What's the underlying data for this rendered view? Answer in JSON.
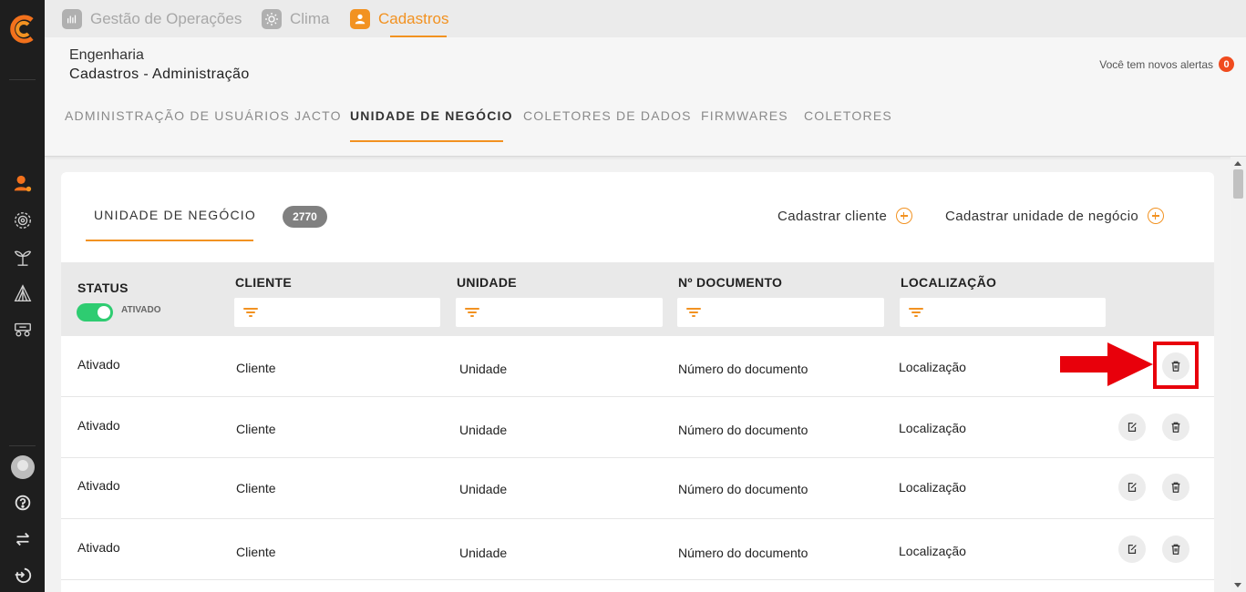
{
  "colors": {
    "accent": "#f29221",
    "sidebar": "#1e1e1e",
    "toggle_on": "#2ecc71",
    "alert": "#f04b1e",
    "highlight": "#e8000b"
  },
  "app_tabs": [
    {
      "label": "Gestão de Operações",
      "icon": "chart-hand-icon"
    },
    {
      "label": "Clima",
      "icon": "sun-icon"
    },
    {
      "label": "Cadastros",
      "icon": "user-icon"
    }
  ],
  "header": {
    "breadcrumb_top": "Engenharia",
    "breadcrumb_title": "Cadastros - Administração",
    "alerts_text": "Você tem novos alertas",
    "alerts_count": "0"
  },
  "subnav": [
    "ADMINISTRAÇÃO DE USUÁRIOS JACTO",
    "UNIDADE DE NEGÓCIO",
    "COLETORES DE DADOS",
    "FIRMWARES",
    "COLETORES"
  ],
  "card": {
    "title": "UNIDADE DE NEGÓCIO",
    "count": "2770",
    "cadastrar_cliente": "Cadastrar cliente",
    "cadastrar_unidade": "Cadastrar unidade de negócio"
  },
  "table": {
    "columns": [
      "STATUS",
      "CLIENTE",
      "UNIDADE",
      "Nº DOCUMENTO",
      "LOCALIZAÇÃO"
    ],
    "status_toggle_label": "ATIVADO",
    "rows": [
      {
        "status": "Ativado",
        "cliente": "Cliente",
        "unidade": "Unidade",
        "documento": "Número do documento",
        "localizacao": "Localização"
      },
      {
        "status": "Ativado",
        "cliente": "Cliente",
        "unidade": "Unidade",
        "documento": "Número do documento",
        "localizacao": "Localização"
      },
      {
        "status": "Ativado",
        "cliente": "Cliente",
        "unidade": "Unidade",
        "documento": "Número do documento",
        "localizacao": "Localização"
      },
      {
        "status": "Ativado",
        "cliente": "Cliente",
        "unidade": "Unidade",
        "documento": "Número do documento",
        "localizacao": "Localização"
      }
    ]
  }
}
